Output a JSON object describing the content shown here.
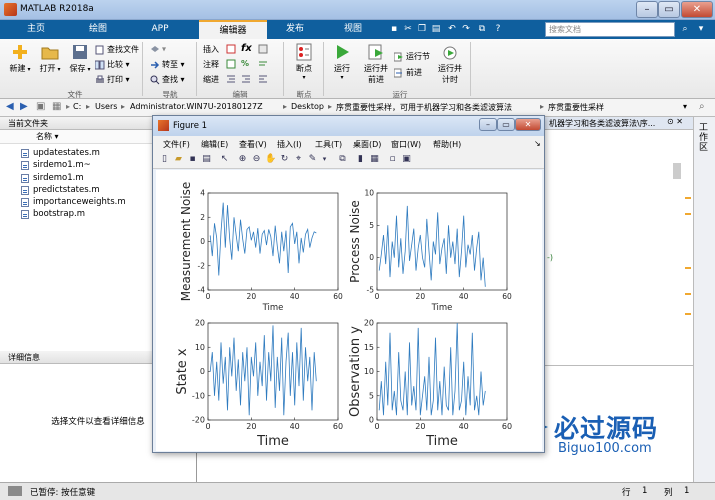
{
  "window": {
    "title": "MATLAB R2018a"
  },
  "tabs": [
    "主页",
    "绘图",
    "APP",
    "编辑器",
    "发布",
    "视图"
  ],
  "active_tab": "编辑器",
  "search": {
    "placeholder": "搜索文档"
  },
  "ribbon": {
    "file_group": {
      "label": "文件",
      "new": "新建",
      "open": "打开",
      "save": "保存",
      "find_files": "查找文件",
      "compare": "比较",
      "print": "打印"
    },
    "nav_group": {
      "label": "导航",
      "goto": "转至",
      "find": "查找"
    },
    "edit_group": {
      "label": "编辑",
      "insert": "插入",
      "comment": "注释",
      "indent": "缩进",
      "fx": "fx"
    },
    "breakpoints_group": {
      "label": "断点",
      "breakpoints": "断点"
    },
    "run_group": {
      "label": "运行",
      "run": "运行",
      "run_advance": "运行并\n前进",
      "run_section": "运行节",
      "advance": "前进",
      "run_time": "运行并\n计时"
    }
  },
  "address": {
    "segments": [
      "C:",
      "Users",
      "Administrator.WIN7U-20180127Z",
      "Desktop",
      "序贯重要性采样，可用于机器学习和各类滤波算法",
      "序贯重要性采样"
    ]
  },
  "current_folder": {
    "title": "当前文件夹",
    "column": "名称",
    "files": [
      "updatestates.m",
      "sirdemo1.m~",
      "sirdemo1.m",
      "predictstates.m",
      "importanceweights.m",
      "bootstrap.m"
    ]
  },
  "details": {
    "title": "详细信息",
    "hint": "选择文件以查看详细信息"
  },
  "editor_tab": {
    "partial_title": "机器学习和各类滤波算法\\序..."
  },
  "workspace_label": "工作区",
  "status": {
    "text": "已暂停: 按任意键",
    "row_label": "行",
    "row": "1",
    "col_label": "列",
    "col": "1"
  },
  "figure": {
    "title": "Figure 1",
    "menus": [
      "文件(F)",
      "编辑(E)",
      "查看(V)",
      "插入(I)",
      "工具(T)",
      "桌面(D)",
      "窗口(W)",
      "帮助(H)"
    ]
  },
  "watermark": {
    "text": "必过源码",
    "url": "Biguo100.com"
  },
  "chart_data": [
    {
      "type": "line",
      "ylabel": "Measurement Noise",
      "xlabel": "Time",
      "xlim": [
        0,
        60
      ],
      "ylim": [
        -4,
        4
      ],
      "xticks": [
        0,
        20,
        40,
        60
      ],
      "yticks": [
        -4,
        -2,
        0,
        2,
        4
      ],
      "color": "#2f7bbf",
      "values": [
        0.5,
        -1.2,
        1.5,
        0.3,
        -2.8,
        0.8,
        3.2,
        -0.5,
        3.0,
        0.2,
        -1.5,
        2.0,
        0.5,
        -0.8,
        1.8,
        0.2,
        -1.0,
        1.0,
        1.2,
        0.1,
        0.8,
        -0.5,
        1.1,
        -1.0,
        0.6,
        0.9,
        -0.3,
        1.0,
        0.4,
        -1.2,
        1.3,
        -0.4,
        -1.8,
        0.8,
        -0.8,
        0.9,
        -2.6,
        1.2,
        1.5,
        -0.2,
        0.8,
        -1.8,
        0.3,
        -0.9,
        0.6,
        1.0,
        -0.5,
        0.3,
        0.8,
        0.7
      ]
    },
    {
      "type": "line",
      "ylabel": "Process Noise",
      "xlabel": "Time",
      "xlim": [
        0,
        60
      ],
      "ylim": [
        -5,
        10
      ],
      "xticks": [
        0,
        20,
        40,
        60
      ],
      "yticks": [
        -5,
        0,
        5,
        10
      ],
      "color": "#2f7bbf",
      "values": [
        -2.0,
        0.5,
        3.5,
        -1.0,
        5.0,
        -3.0,
        2.5,
        0.0,
        6.5,
        -1.5,
        3.0,
        -2.5,
        1.0,
        8.0,
        -0.5,
        2.0,
        4.5,
        -2.0,
        1.5,
        3.5,
        0.0,
        -1.5,
        6.0,
        1.0,
        -3.5,
        2.5,
        0.5,
        7.0,
        -1.0,
        1.5,
        3.0,
        -2.5,
        5.0,
        0.0,
        2.5,
        -1.0,
        4.5,
        -3.0,
        1.0,
        6.5,
        -1.5,
        2.0,
        0.5,
        3.5,
        -2.0,
        1.5,
        4.0,
        -3.5,
        0.0,
        -4.5
      ]
    },
    {
      "type": "line",
      "ylabel": "State x",
      "xlabel": "Time",
      "xlim": [
        0,
        60
      ],
      "ylim": [
        -20,
        20
      ],
      "xticks": [
        0,
        20,
        40,
        60
      ],
      "yticks": [
        -20,
        -10,
        0,
        10,
        20
      ],
      "color": "#2f7bbf",
      "values": [
        0,
        8,
        -10,
        4,
        -12,
        12,
        -5,
        6,
        -16,
        10,
        -2,
        14,
        -8,
        5,
        -14,
        8,
        -4,
        10,
        -18,
        6,
        -2,
        12,
        -10,
        4,
        -6,
        15,
        -12,
        8,
        -4,
        19,
        -15,
        6,
        -8,
        14,
        -18,
        4,
        16,
        -10,
        8,
        -14,
        12,
        -6,
        18,
        -12,
        10,
        -4,
        6,
        -16,
        8,
        -4
      ]
    },
    {
      "type": "line",
      "ylabel": "Observation y",
      "xlabel": "Time",
      "xlim": [
        0,
        60
      ],
      "ylim": [
        0,
        20
      ],
      "xticks": [
        0,
        20,
        40,
        60
      ],
      "yticks": [
        0,
        5,
        10,
        15,
        20
      ],
      "color": "#2f7bbf",
      "values": [
        2,
        8,
        1,
        12,
        3,
        18,
        2,
        6,
        1,
        14,
        4,
        2,
        10,
        1,
        16,
        3,
        7,
        2,
        19,
        1,
        5,
        9,
        2,
        13,
        1,
        4,
        17,
        2,
        8,
        1,
        11,
        3,
        2,
        15,
        1,
        6,
        20,
        2,
        4,
        12,
        1,
        9,
        3,
        18,
        2,
        5,
        1,
        10,
        3,
        6
      ]
    }
  ]
}
